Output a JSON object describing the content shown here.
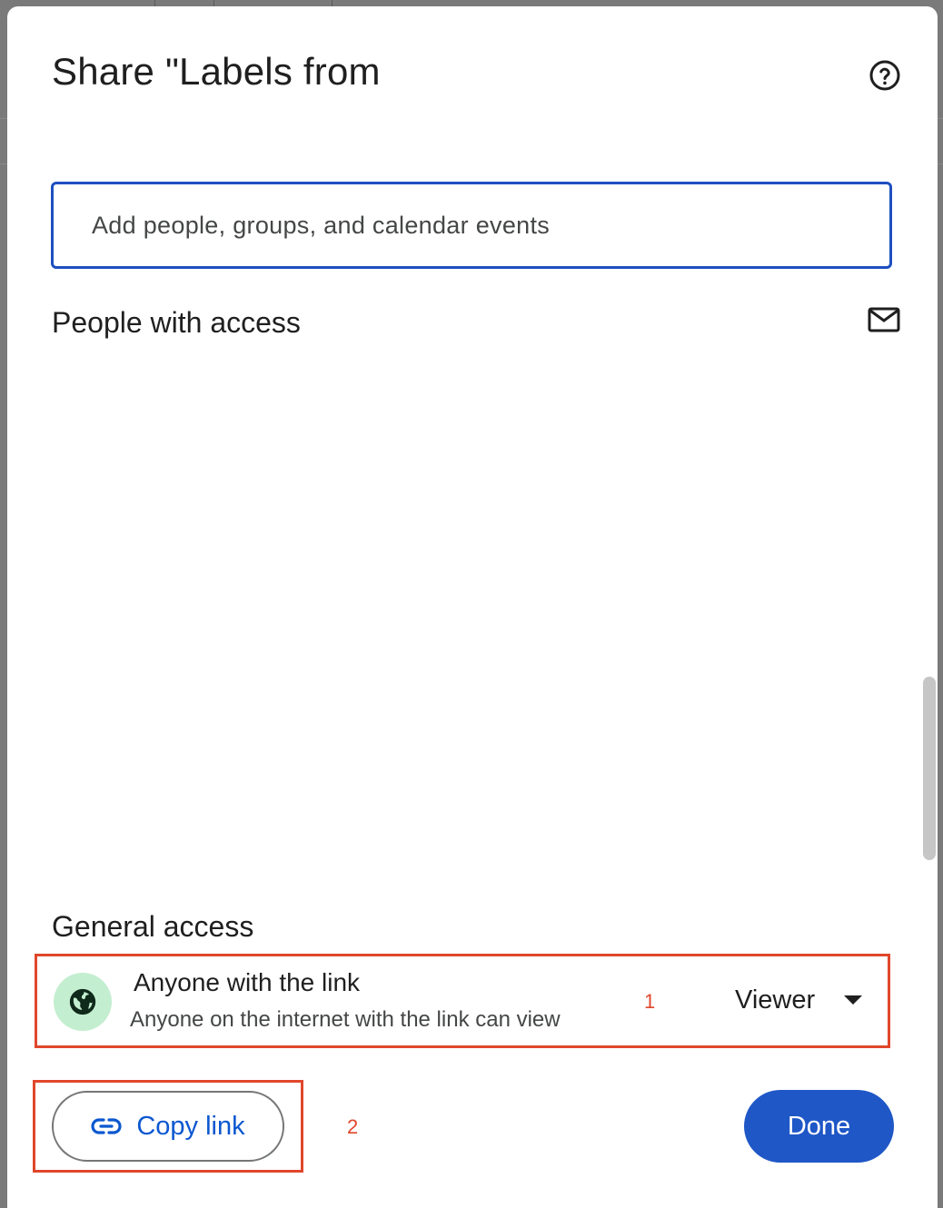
{
  "dialog": {
    "title": "Share \"Labels from",
    "help_icon": "help-circle-icon"
  },
  "search": {
    "placeholder": "Add people, groups, and calendar events",
    "value": ""
  },
  "people_section": {
    "title": "People with access",
    "mail_icon": "mail-icon"
  },
  "general_access": {
    "title": "General access",
    "icon": "globe-icon",
    "type": "Anyone with the link",
    "description": "Anyone on the internet with the link can view",
    "role": "Viewer",
    "role_caret": "caret-down-icon",
    "marker": "1"
  },
  "footer": {
    "copy_link_label": "Copy link",
    "copy_link_icon": "link-icon",
    "copy_marker": "2",
    "done_label": "Done"
  },
  "colors": {
    "accent_blue": "#1f57c7",
    "link_blue": "#0b57d0",
    "annotation_red": "#e0472c",
    "globe_bg": "#c4eed0"
  }
}
